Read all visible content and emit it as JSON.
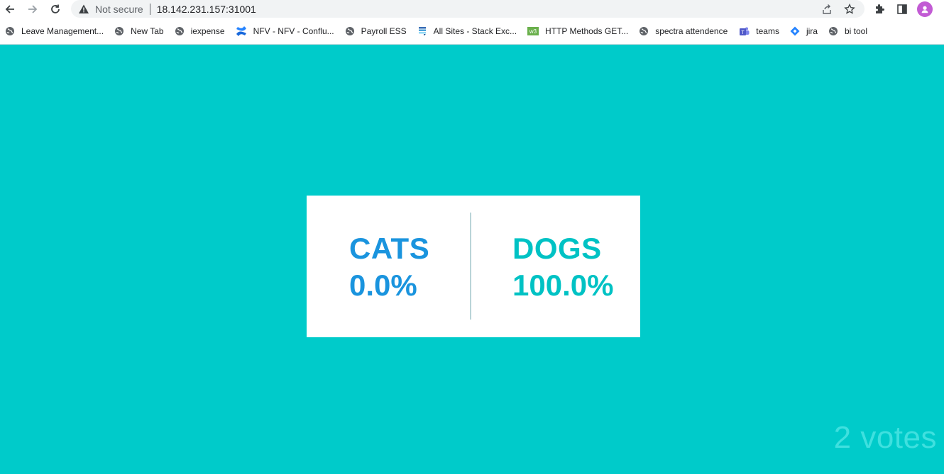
{
  "browser": {
    "security_label": "Not secure",
    "url": "18.142.231.157:31001",
    "bookmarks": [
      {
        "label": "Leave Management...",
        "icon": "globe-icon"
      },
      {
        "label": "New Tab",
        "icon": "globe-icon"
      },
      {
        "label": "iexpense",
        "icon": "globe-icon"
      },
      {
        "label": "NFV - NFV - Conflu...",
        "icon": "confluence-icon"
      },
      {
        "label": "Payroll ESS",
        "icon": "globe-icon"
      },
      {
        "label": "All Sites - Stack Exc...",
        "icon": "stackexchange-icon"
      },
      {
        "label": "HTTP Methods GET...",
        "icon": "w3-icon"
      },
      {
        "label": "spectra attendence",
        "icon": "globe-icon"
      },
      {
        "label": "teams",
        "icon": "teams-icon"
      },
      {
        "label": "jira",
        "icon": "jira-icon"
      },
      {
        "label": "bi tool",
        "icon": "globe-icon"
      }
    ]
  },
  "results": {
    "option_a": {
      "label": "CATS",
      "percent": "0.0%"
    },
    "option_b": {
      "label": "DOGS",
      "percent": "100.0%"
    },
    "votes": "2 votes"
  },
  "colors": {
    "background": "#00cbca",
    "cats": "#1a94de",
    "dogs": "#00c2c4",
    "votes": "#3fe0df"
  }
}
